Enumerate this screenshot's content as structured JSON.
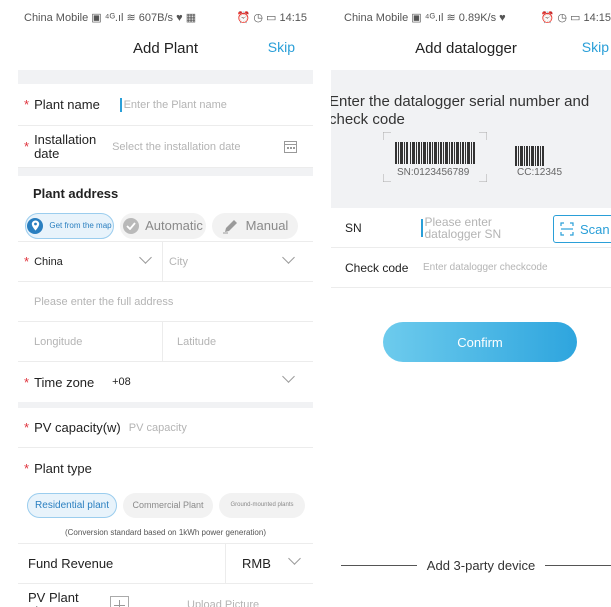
{
  "left": {
    "status_bar": {
      "carrier": "China Mobile",
      "speed": "607B/s",
      "time": "14:15"
    },
    "title": "Add Plant",
    "skip": "Skip",
    "plant_name": {
      "label": "Plant name",
      "placeholder": "Enter the Plant name"
    },
    "installation_date": {
      "label": "Installation date",
      "placeholder": "Select the installation date"
    },
    "plant_address": {
      "title": "Plant address",
      "options": [
        "Get from the map",
        "Automatic",
        "Manual"
      ],
      "active_option": "Get from the map",
      "country": "China",
      "city_placeholder": "City",
      "full_address_placeholder": "Please enter the full address",
      "longitude_placeholder": "Longitude",
      "latitude_placeholder": "Latitude"
    },
    "time_zone": {
      "label": "Time zone",
      "value": "+08"
    },
    "pv_capacity": {
      "label": "PV capacity(w)",
      "placeholder": "PV capacity"
    },
    "plant_type": {
      "label": "Plant type",
      "options": [
        "Residential plant",
        "Commercial Plant",
        "Ground-mounted plants"
      ],
      "active_option": "Residential plant",
      "note": "(Conversion standard based on 1kWh power generation)"
    },
    "fund_revenue": {
      "label": "Fund Revenue",
      "currency": "RMB"
    },
    "pv_plant_picture": {
      "label": "PV Plant picture",
      "upload": "Upload Picture"
    },
    "colors": {
      "accent": "#2a9fd8",
      "required": "#e0323c"
    }
  },
  "right": {
    "status_bar": {
      "carrier": "China Mobile",
      "speed": "0.89K/s",
      "time": "14:15"
    },
    "title": "Add datalogger",
    "skip": "Skip",
    "instruction": "Enter the datalogger serial number and check code",
    "sample_sn": "SN:0123456789",
    "sample_cc": "CC:12345",
    "sn": {
      "label": "SN",
      "placeholder": "Please enter datalogger SN",
      "scan": "Scan"
    },
    "check_code": {
      "label": "Check code",
      "placeholder": "Enter datalogger checkcode"
    },
    "confirm": "Confirm",
    "add_3party": "Add 3-party device"
  }
}
